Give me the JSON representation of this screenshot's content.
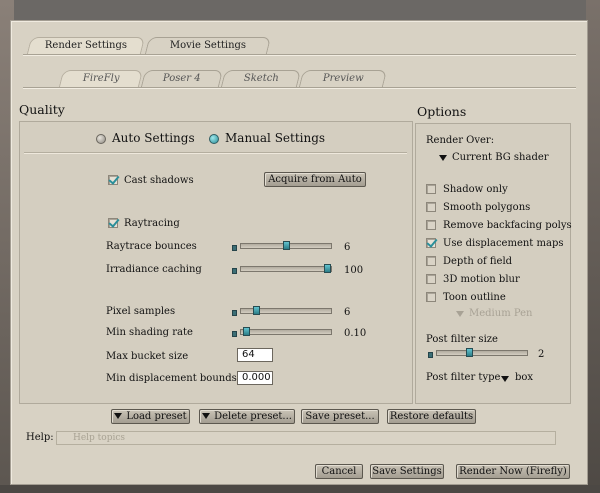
{
  "tabs": {
    "main": [
      "Render Settings",
      "Movie Settings"
    ],
    "sub": [
      "FireFly",
      "Poser 4",
      "Sketch",
      "Preview"
    ]
  },
  "quality": {
    "heading": "Quality",
    "auto_label": "Auto Settings",
    "manual_label": "Manual Settings",
    "selected": "Manual Settings",
    "cast_shadows_label": "Cast shadows",
    "cast_shadows_checked": true,
    "acquire_label": "Acquire from Auto",
    "raytracing_label": "Raytracing",
    "raytracing_checked": true,
    "raytrace_bounces": {
      "label": "Raytrace bounces",
      "value": "6",
      "level": 0.5
    },
    "irradiance_caching": {
      "label": "Irradiance caching",
      "value": "100",
      "level": 1.0
    },
    "pixel_samples": {
      "label": "Pixel samples",
      "value": "6",
      "level": 0.15
    },
    "min_shading_rate": {
      "label": "Min shading rate",
      "value": "0.10",
      "level": 0.02
    },
    "max_bucket_size": {
      "label": "Max bucket size",
      "value": "64"
    },
    "min_displacement_bounds": {
      "label": "Min displacement bounds",
      "value": "0.000"
    }
  },
  "options": {
    "heading": "Options",
    "render_over_label": "Render Over:",
    "render_over_value": "Current BG shader",
    "checkboxes": [
      {
        "label": "Shadow only",
        "checked": false
      },
      {
        "label": "Smooth polygons",
        "checked": false
      },
      {
        "label": "Remove backfacing polys",
        "checked": false
      },
      {
        "label": "Use displacement maps",
        "checked": true
      },
      {
        "label": "Depth of field",
        "checked": false
      },
      {
        "label": "3D motion blur",
        "checked": false
      },
      {
        "label": "Toon outline",
        "checked": false
      }
    ],
    "toon_pen": "Medium Pen",
    "post_filter_size": {
      "label": "Post filter size",
      "value": "2",
      "level": 0.35
    },
    "post_filter_type_label": "Post filter type",
    "post_filter_type_value": "box"
  },
  "presets": {
    "load": "Load preset",
    "delete": "Delete preset...",
    "save": "Save preset...",
    "restore": "Restore defaults"
  },
  "help": {
    "label": "Help:",
    "placeholder": "Help topics"
  },
  "footer": {
    "cancel": "Cancel",
    "save_settings": "Save Settings",
    "render_now": "Render Now (Firefly)"
  },
  "colors": {
    "accent": "#2a8f9a",
    "dialog_bg": "#d8d2c4"
  }
}
